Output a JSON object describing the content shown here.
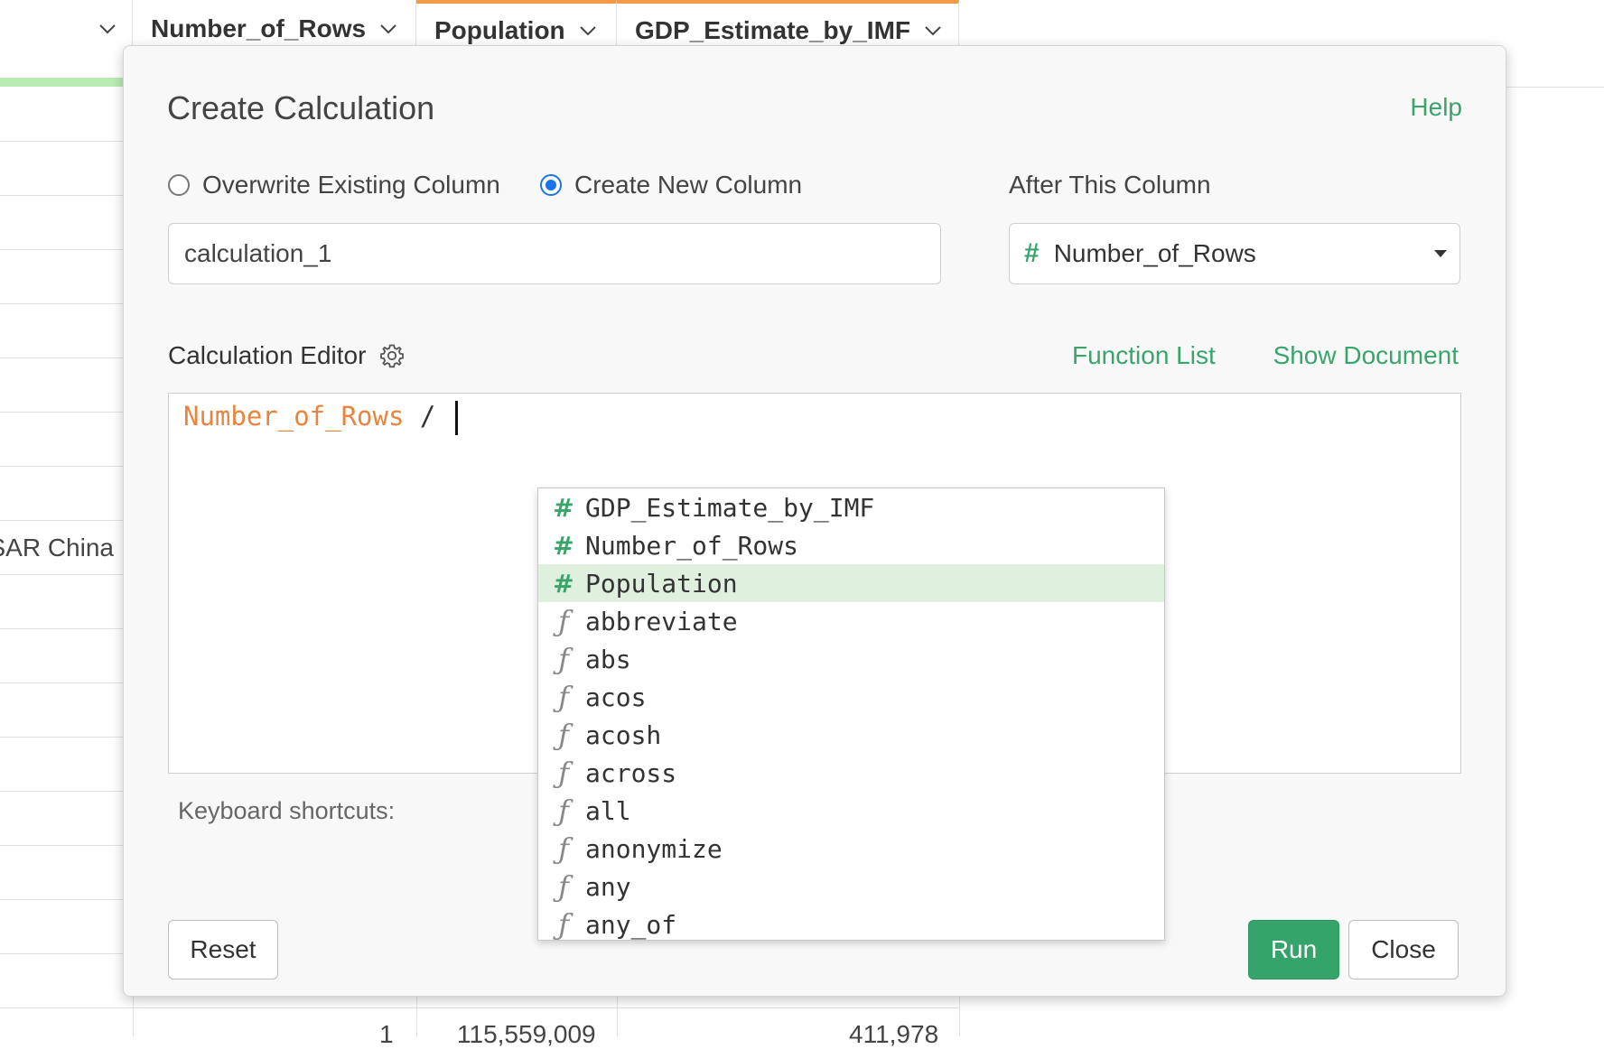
{
  "grid": {
    "headers": [
      {
        "label": ""
      },
      {
        "label": "Number_of_Rows"
      },
      {
        "label": "Population"
      },
      {
        "label": "GDP_Estimate_by_IMF"
      }
    ],
    "visible_cell": "SAR China",
    "bottom_row": {
      "num_rows": "1",
      "population": "115,559,009",
      "gdp": "411,978"
    }
  },
  "dialog": {
    "title": "Create Calculation",
    "help_link": "Help",
    "radio_overwrite": "Overwrite Existing Column",
    "radio_new": "Create New Column",
    "selected_mode": "Create New Column",
    "new_column_name": "calculation_1",
    "after_label": "After This Column",
    "after_column": "Number_of_Rows",
    "editor_label": "Calculation Editor",
    "function_list_link": "Function List",
    "show_document_link": "Show Document",
    "expression_field": "Number_of_Rows",
    "expression_op": " /",
    "shortcuts_label": "Keyboard shortcuts:",
    "reset_button": "Reset",
    "run_button": "Run",
    "close_button": "Close"
  },
  "autocomplete": [
    {
      "kind": "column",
      "label": "GDP_Estimate_by_IMF"
    },
    {
      "kind": "column",
      "label": "Number_of_Rows"
    },
    {
      "kind": "column",
      "label": "Population",
      "selected": true
    },
    {
      "kind": "function",
      "label": "abbreviate"
    },
    {
      "kind": "function",
      "label": "abs"
    },
    {
      "kind": "function",
      "label": "acos"
    },
    {
      "kind": "function",
      "label": "acosh"
    },
    {
      "kind": "function",
      "label": "across"
    },
    {
      "kind": "function",
      "label": "all"
    },
    {
      "kind": "function",
      "label": "anonymize"
    },
    {
      "kind": "function",
      "label": "any"
    },
    {
      "kind": "function",
      "label": "any_of"
    }
  ],
  "colors": {
    "accent": "#35a46a",
    "link": "#3aa56b",
    "field": "#e8843d",
    "header_accent": "#f09a4a",
    "radio": "#1a73e8"
  }
}
